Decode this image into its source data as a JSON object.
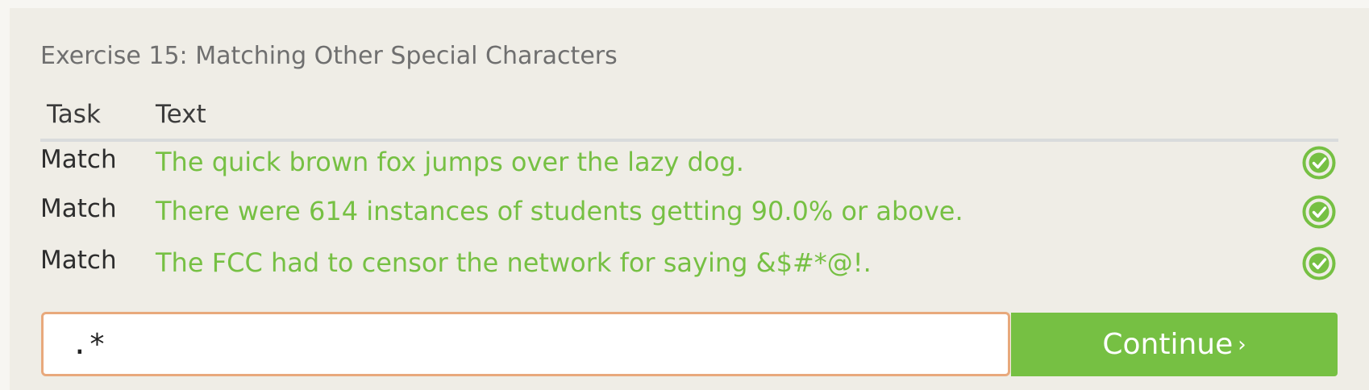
{
  "exercise": {
    "title": "Exercise 15: Matching Other Special Characters"
  },
  "table": {
    "headers": {
      "task": "Task",
      "text": "Text"
    },
    "rows": [
      {
        "task": "Match",
        "text": "The quick brown fox jumps over the lazy dog.",
        "status": "check-icon"
      },
      {
        "task": "Match",
        "text": "There were 614 instances of students getting 90.0% or above.",
        "status": "check-icon"
      },
      {
        "task": "Match",
        "text": "The FCC had to censor the network for saying &$#*@!.",
        "status": "check-icon"
      }
    ]
  },
  "input": {
    "value": ".*"
  },
  "continue_button": {
    "label": "Continue",
    "chevron": "›"
  },
  "colors": {
    "success_green": "#76c043",
    "input_border": "#e8a97c",
    "panel_bg": "#efede6"
  }
}
